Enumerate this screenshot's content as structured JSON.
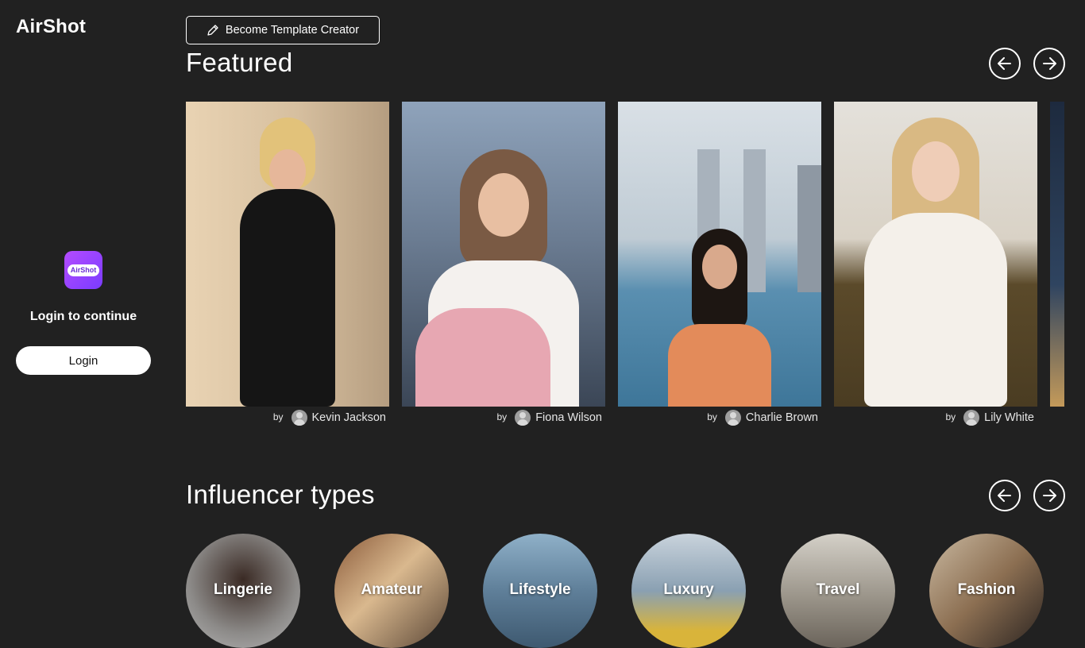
{
  "sidebar": {
    "brand": "AirShot",
    "app_icon_text": "AirShot",
    "login_prompt": "Login to continue",
    "login_label": "Login"
  },
  "header": {
    "creator_button_label": "Become Template Creator",
    "creator_icon": "pencil-icon"
  },
  "featured": {
    "title": "Featured",
    "prev_icon": "arrow-left-icon",
    "next_icon": "arrow-right-icon",
    "by_label": "by",
    "cards": [
      {
        "author": "Kevin Jackson",
        "bg": "#d9c4a8"
      },
      {
        "author": "Fiona Wilson",
        "bg": "#7d8ea3"
      },
      {
        "author": "Charlie Brown",
        "bg": "#a9b8c4"
      },
      {
        "author": "Lily White",
        "bg": "#c7b9a4"
      }
    ]
  },
  "influencer_types": {
    "title": "Influencer types",
    "items": [
      {
        "label": "Lingerie"
      },
      {
        "label": "Amateur"
      },
      {
        "label": "Lifestyle"
      },
      {
        "label": "Luxury"
      },
      {
        "label": "Travel"
      },
      {
        "label": "Fashion"
      }
    ]
  },
  "colors": {
    "background": "#212121",
    "accent": "#8a3ffc"
  }
}
